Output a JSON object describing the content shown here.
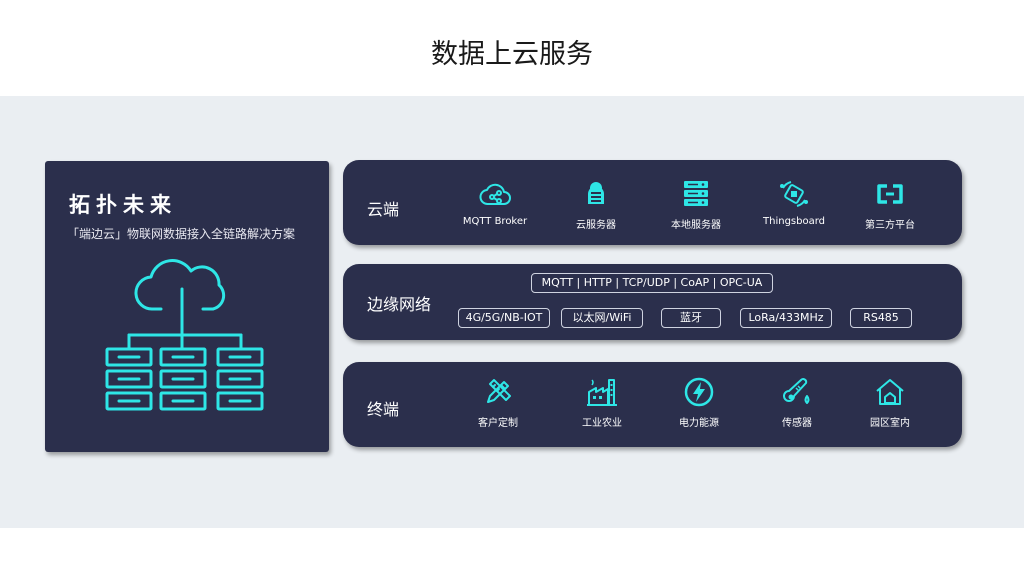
{
  "title": "数据上云服务",
  "left": {
    "heading": "拓扑未来",
    "subtitle": "「端边云」物联网数据接入全链路解决方案"
  },
  "cloud": {
    "label": "云端",
    "items": [
      {
        "label": "MQTT Broker",
        "icon": "cloud-share-icon"
      },
      {
        "label": "云服务器",
        "icon": "cloud-server-icon"
      },
      {
        "label": "本地服务器",
        "icon": "server-rack-icon"
      },
      {
        "label": "Thingsboard",
        "icon": "thingsboard-icon"
      },
      {
        "label": "第三方平台",
        "icon": "link-platform-icon"
      }
    ]
  },
  "edge": {
    "label": "边缘网络",
    "protocols": "MQTT | HTTP | TCP/UDP | CoAP | OPC-UA",
    "networks": [
      "4G/5G/NB-IOT",
      "以太网/WiFi",
      "蓝牙",
      "LoRa/433MHz",
      "RS485"
    ]
  },
  "terminal": {
    "label": "终端",
    "items": [
      {
        "label": "客户定制",
        "icon": "customize-tools-icon"
      },
      {
        "label": "工业农业",
        "icon": "factory-icon"
      },
      {
        "label": "电力能源",
        "icon": "lightning-icon"
      },
      {
        "label": "传感器",
        "icon": "thermometer-icon"
      },
      {
        "label": "园区室内",
        "icon": "house-icon"
      }
    ]
  },
  "colors": {
    "panel": "#2b2f4c",
    "accent": "#2ee6e6",
    "band": "#eaeef2"
  }
}
